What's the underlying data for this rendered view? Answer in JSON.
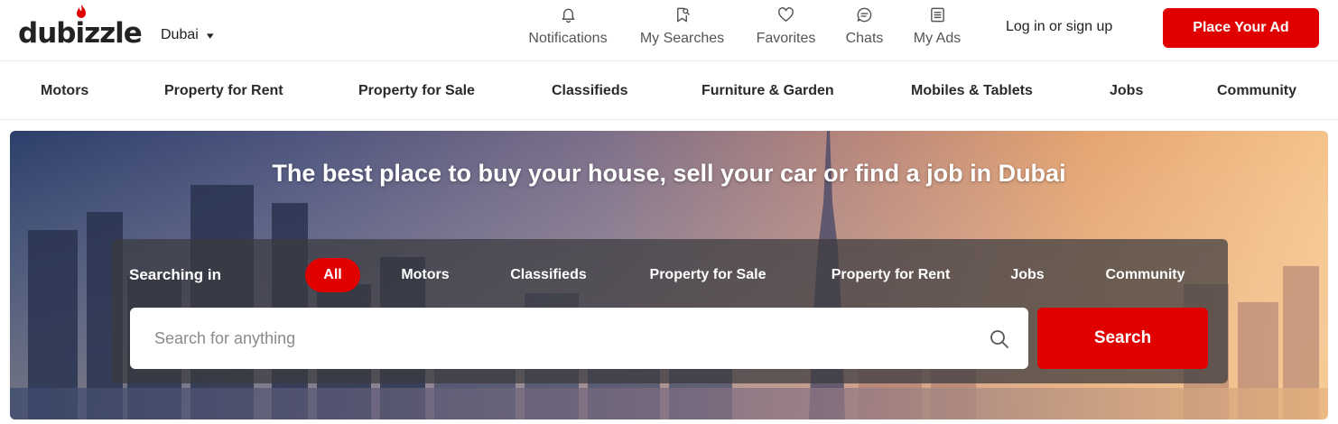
{
  "brand": {
    "logo_text": "dubizzle",
    "accent_color": "#e00000"
  },
  "header": {
    "city": "Dubai",
    "nav": [
      {
        "label": "Notifications",
        "icon": "bell-icon"
      },
      {
        "label": "My Searches",
        "icon": "saved-search-icon"
      },
      {
        "label": "Favorites",
        "icon": "heart-icon"
      },
      {
        "label": "Chats",
        "icon": "chat-bubble-icon"
      },
      {
        "label": "My Ads",
        "icon": "list-doc-icon"
      }
    ],
    "login_label": "Log in or sign up",
    "place_ad_label": "Place Your Ad"
  },
  "categories": [
    "Motors",
    "Property for Rent",
    "Property for Sale",
    "Classifieds",
    "Furniture & Garden",
    "Mobiles & Tablets",
    "Jobs",
    "Community"
  ],
  "hero": {
    "title": "The best place to buy your house, sell your car or find a job in Dubai",
    "search": {
      "label": "Searching in",
      "tabs": [
        "All",
        "Motors",
        "Classifieds",
        "Property for Sale",
        "Property for Rent",
        "Jobs",
        "Community"
      ],
      "active_tab": "All",
      "placeholder": "Search for anything",
      "value": "",
      "button_label": "Search"
    }
  }
}
